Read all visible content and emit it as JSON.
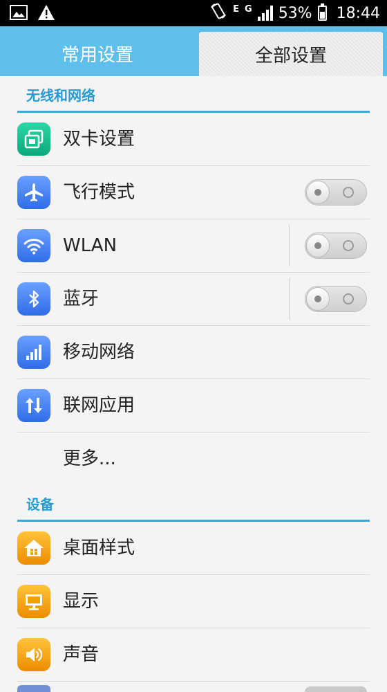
{
  "status_bar": {
    "battery": "53%",
    "network_type_1": "E",
    "network_type_2": "G",
    "time": "18:44"
  },
  "tabs": [
    {
      "label": "常用设置",
      "selected": false
    },
    {
      "label": "全部设置",
      "selected": true
    }
  ],
  "sections": {
    "wireless": {
      "title": "无线和网络",
      "items": [
        {
          "label": "双卡设置",
          "icon": "dual-sim-icon"
        },
        {
          "label": "飞行模式",
          "icon": "airplane-icon",
          "toggle": "off"
        },
        {
          "label": "WLAN",
          "icon": "wifi-icon",
          "toggle": "off"
        },
        {
          "label": "蓝牙",
          "icon": "bluetooth-icon",
          "toggle": "off"
        },
        {
          "label": "移动网络",
          "icon": "mobile-network-icon"
        },
        {
          "label": "联网应用",
          "icon": "data-transfer-icon"
        },
        {
          "label": "更多..."
        }
      ]
    },
    "device": {
      "title": "设备",
      "items": [
        {
          "label": "桌面样式",
          "icon": "home-icon"
        },
        {
          "label": "显示",
          "icon": "display-icon"
        },
        {
          "label": "声音",
          "icon": "speaker-icon"
        }
      ]
    }
  },
  "colors": {
    "accent": "#36a9d6",
    "tab_bar": "#5ec0ea",
    "section_text": "#2a9bd0"
  }
}
